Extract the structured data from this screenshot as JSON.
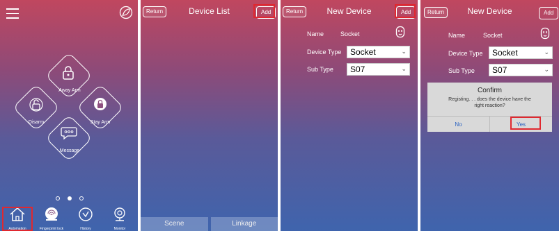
{
  "screen1": {
    "buttons": {
      "away_arm": "Away Arm",
      "disarm": "Disarm",
      "stay_arm": "Stay Arm",
      "message": "Message"
    },
    "tabs": [
      "Automation",
      "Fingerprint lock",
      "History",
      "Monitor"
    ],
    "active_tab": 0,
    "page_dots": 3,
    "active_dot": 1
  },
  "screen2": {
    "return_label": "Return",
    "title": "Device  List",
    "add_label": "Add",
    "bottom": [
      "Scene",
      "Linkage"
    ]
  },
  "screen3": {
    "return_label": "Return",
    "title": "New Device",
    "add_label": "Add",
    "name_label": "Name",
    "name_value": "Socket",
    "device_type_label": "Device Type",
    "device_type_value": "Socket",
    "sub_type_label": "Sub Type",
    "sub_type_value": "S07"
  },
  "screen4": {
    "return_label": "Return",
    "title": "New Device",
    "add_label": "Add",
    "name_label": "Name",
    "name_value": "Socket",
    "device_type_label": "Device Type",
    "device_type_value": "Socket",
    "sub_type_label": "Sub Type",
    "sub_type_value": "S07",
    "dialog": {
      "title": "Confirm",
      "message_line1": "Registing. . .  does the device have the",
      "message_line2": "right reaction?",
      "no_label": "No",
      "yes_label": "Yes"
    }
  },
  "colors": {
    "highlight": "#e0282f",
    "gradient_top": "#c0475f",
    "gradient_bottom": "#3f64ad"
  }
}
